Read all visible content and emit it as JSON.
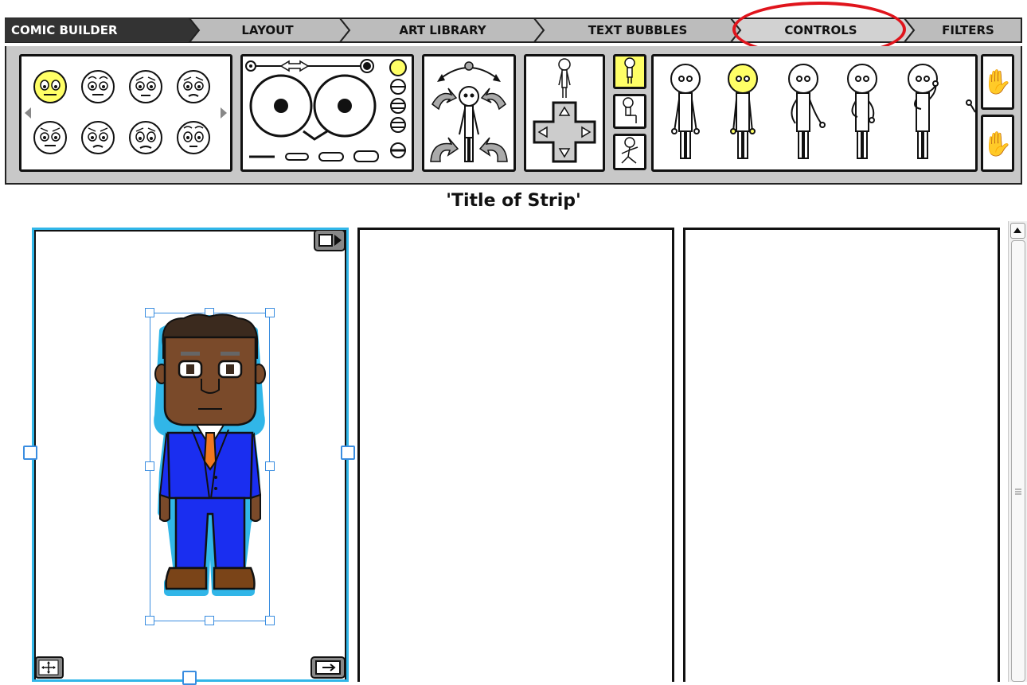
{
  "tabs": [
    {
      "label": "COMIC BUILDER",
      "state": "dark"
    },
    {
      "label": "LAYOUT",
      "state": "normal"
    },
    {
      "label": "ART LIBRARY",
      "state": "normal"
    },
    {
      "label": "TEXT BUBBLES",
      "state": "normal"
    },
    {
      "label": "CONTROLS",
      "state": "active"
    },
    {
      "label": "FILTERS",
      "state": "normal"
    }
  ],
  "strip": {
    "title": "'Title of Strip'"
  },
  "colors": {
    "highlight_circle": "#e0141c",
    "selected_yellow": "#ffff66",
    "selection_blue": "#31b6e8",
    "suit_blue": "#1a2ef0",
    "tie_orange": "#f07820",
    "skin_brown": "#7a4a2a"
  },
  "icons": {
    "face_expressions": [
      "neutral-face-icon",
      "smile-face-icon",
      "worried-face-icon",
      "sad-face-icon",
      "angry-face-icon",
      "grumpy-face-icon",
      "crying-face-icon",
      "surprised-face-icon"
    ],
    "hands": [
      "open-hand-icon",
      "open-hand-icon"
    ]
  }
}
